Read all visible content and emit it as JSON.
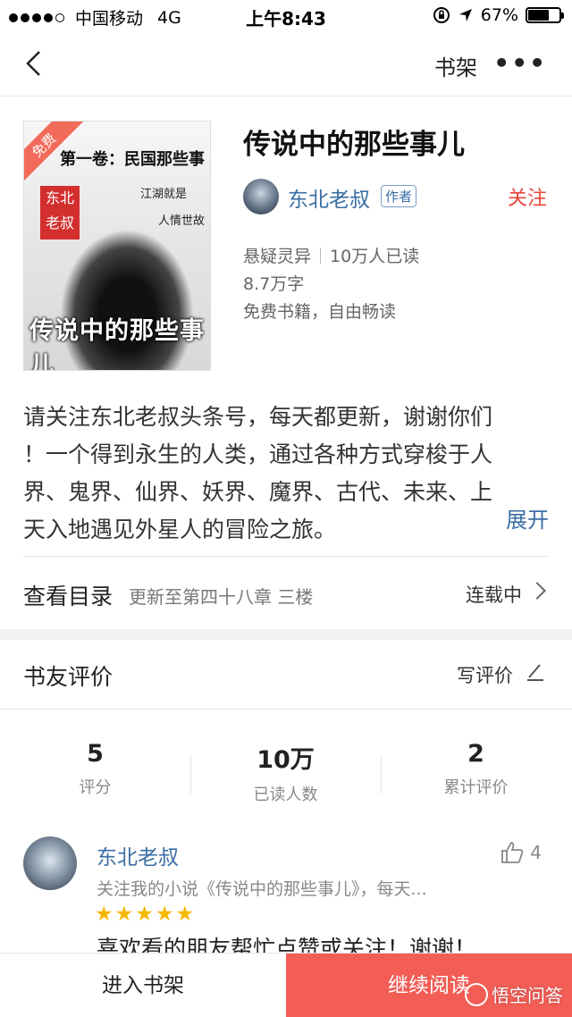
{
  "status_bar": {
    "carrier": "中国移动",
    "network": "4G",
    "time": "上午8:43",
    "battery": "67%",
    "battery_level": 0.67
  },
  "nav": {
    "shelf_label": "书架",
    "more_label": "•••"
  },
  "book": {
    "cover": {
      "badge": "免费",
      "volume": "第一卷：民国那些事",
      "seal": "东北老叔",
      "side_text_1": "江湖就是",
      "side_text_2": "人情世故",
      "cover_title": "传说中的那些事儿"
    },
    "title": "传说中的那些事儿",
    "author": "东北老叔",
    "author_tag": "作者",
    "follow_label": "关注",
    "genre": "悬疑灵异",
    "readers": "10万人已读",
    "word_count": "8.7万字",
    "free_note": "免费书籍，自由畅读"
  },
  "description": {
    "lines": [
      "请关注东北老叔头条号，每天都更新，谢谢你们",
      "！一个得到永生的人类，通过各种方式穿梭于人",
      "界、鬼界、仙界、妖界、魔界、古代、未来、上",
      "天入地遇见外星人的冒险之旅。"
    ],
    "expand_label": "展开"
  },
  "toc": {
    "label": "查看目录",
    "update": "更新至第四十八章 三楼",
    "state": "连载中"
  },
  "reviews": {
    "title": "书友评价",
    "write_label": "写评价",
    "stats": [
      {
        "value": "5",
        "label": "评分"
      },
      {
        "value": "10万",
        "label": "已读人数"
      },
      {
        "value": "2",
        "label": "累计评价"
      }
    ],
    "comment": {
      "user": "东北老叔",
      "likes": "4",
      "quote": "关注我的小说《传说中的那些事儿》，每天...",
      "rating": 5,
      "text": "喜欢看的朋友帮忙点赞或关注！谢谢！"
    }
  },
  "bottom_bar": {
    "add_shelf_label": "进入书架",
    "continue_label": "继续阅读",
    "watermark": "悟空问答"
  }
}
